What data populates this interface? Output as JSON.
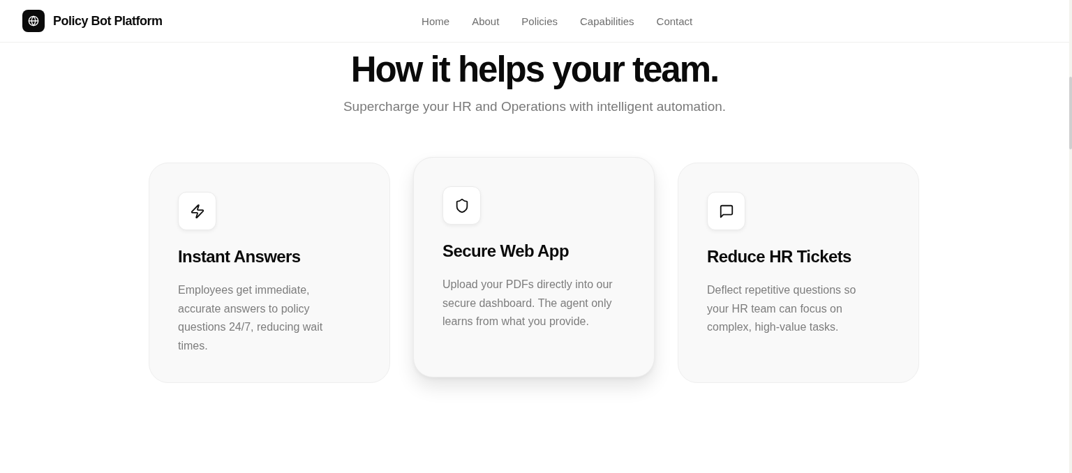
{
  "header": {
    "brand": "Policy Bot Platform",
    "nav": [
      {
        "label": "Home"
      },
      {
        "label": "About"
      },
      {
        "label": "Policies"
      },
      {
        "label": "Capabilities"
      },
      {
        "label": "Contact"
      }
    ]
  },
  "hero": {
    "title": "How it helps your team.",
    "subtitle": "Supercharge your HR and Operations with intelligent automation."
  },
  "features": [
    {
      "kind": "lightning",
      "title": "Instant Answers",
      "description": "Employees get immediate, accurate answers to policy questions 24/7, reducing wait times.",
      "highlighted": false
    },
    {
      "kind": "shield",
      "title": "Secure Web App",
      "description": "Upload your PDFs directly into our secure dashboard. The agent only learns from what you provide.",
      "highlighted": true
    },
    {
      "kind": "chat",
      "title": "Reduce HR Tickets",
      "description": "Deflect repetitive questions so your HR team can focus on complex, high-value tasks.",
      "highlighted": false
    }
  ]
}
